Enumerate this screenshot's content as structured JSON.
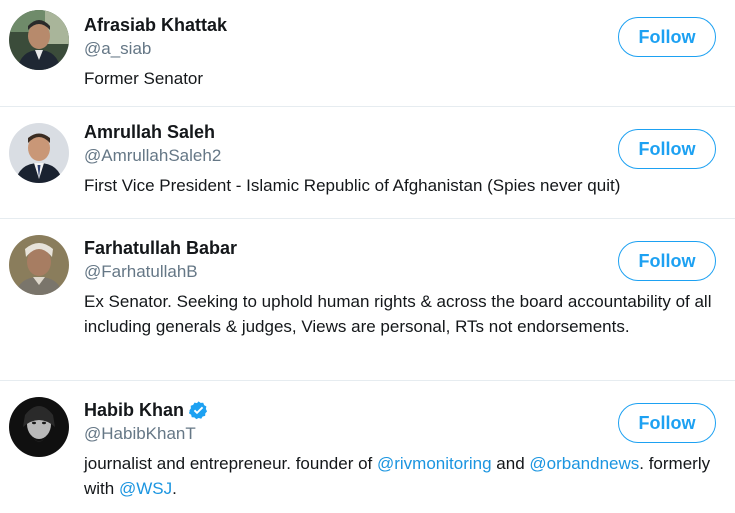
{
  "users": [
    {
      "name": "Afrasiab Khattak",
      "handle": "@a_siab",
      "bio": "Former Senator",
      "follow_label": "Follow",
      "verified": false
    },
    {
      "name": "Amrullah Saleh",
      "handle": "@AmrullahSaleh2",
      "bio": "First Vice President - Islamic Republic of Afghanistan (Spies never quit)",
      "follow_label": "Follow",
      "verified": false
    },
    {
      "name": "Farhatullah Babar",
      "handle": "@FarhatullahB",
      "bio": "Ex Senator. Seeking to uphold human rights & across the board accountability of all including generals & judges, Views are personal, RTs not endorsements.",
      "follow_label": "Follow",
      "verified": false
    },
    {
      "name": "Habib Khan",
      "handle": "@HabibKhanT",
      "bio_parts": {
        "p1": "journalist and entrepreneur. founder of ",
        "m1": "@rivmonitoring",
        "p2": " and ",
        "m2": "@orbandnews",
        "p3": ". formerly with ",
        "m3": "@WSJ",
        "p4": "."
      },
      "follow_label": "Follow",
      "verified": true
    }
  ],
  "colors": {
    "accent": "#1da1f2",
    "link": "#1b95e0",
    "handle_gray": "#657786",
    "divider": "#e6ecf0"
  },
  "icons": {
    "verified": "verified-badge-icon"
  }
}
